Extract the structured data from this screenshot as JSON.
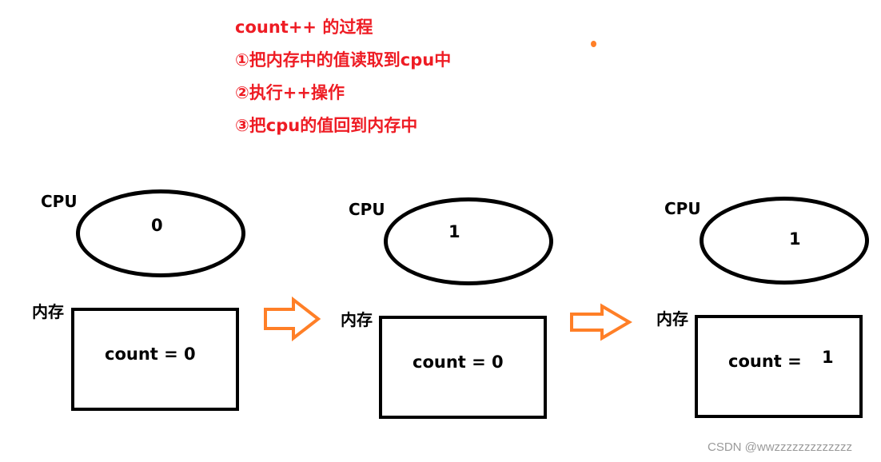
{
  "notes": {
    "title": "count++ 的过程",
    "step1": "①把内存中的值读取到cpu中",
    "step2": "②执行++操作",
    "step3": "③把cpu的值回到内存中"
  },
  "colors": {
    "note_text": "#ee1c24",
    "arrow": "#ff7f27",
    "outline": "#000000",
    "watermark": "#9a9a9a"
  },
  "stages": [
    {
      "cpu_label": "CPU",
      "cpu_value": "0",
      "memory_label": "内存",
      "memory_text": "count = 0",
      "memory_value": ""
    },
    {
      "cpu_label": "CPU",
      "cpu_value": "1",
      "memory_label": "内存",
      "memory_text": "count = 0",
      "memory_value": ""
    },
    {
      "cpu_label": "CPU",
      "cpu_value": "1",
      "memory_label": "内存",
      "memory_text": "count =",
      "memory_value": "1"
    }
  ],
  "watermark": "CSDN @wwzzzzzzzzzzzzz"
}
